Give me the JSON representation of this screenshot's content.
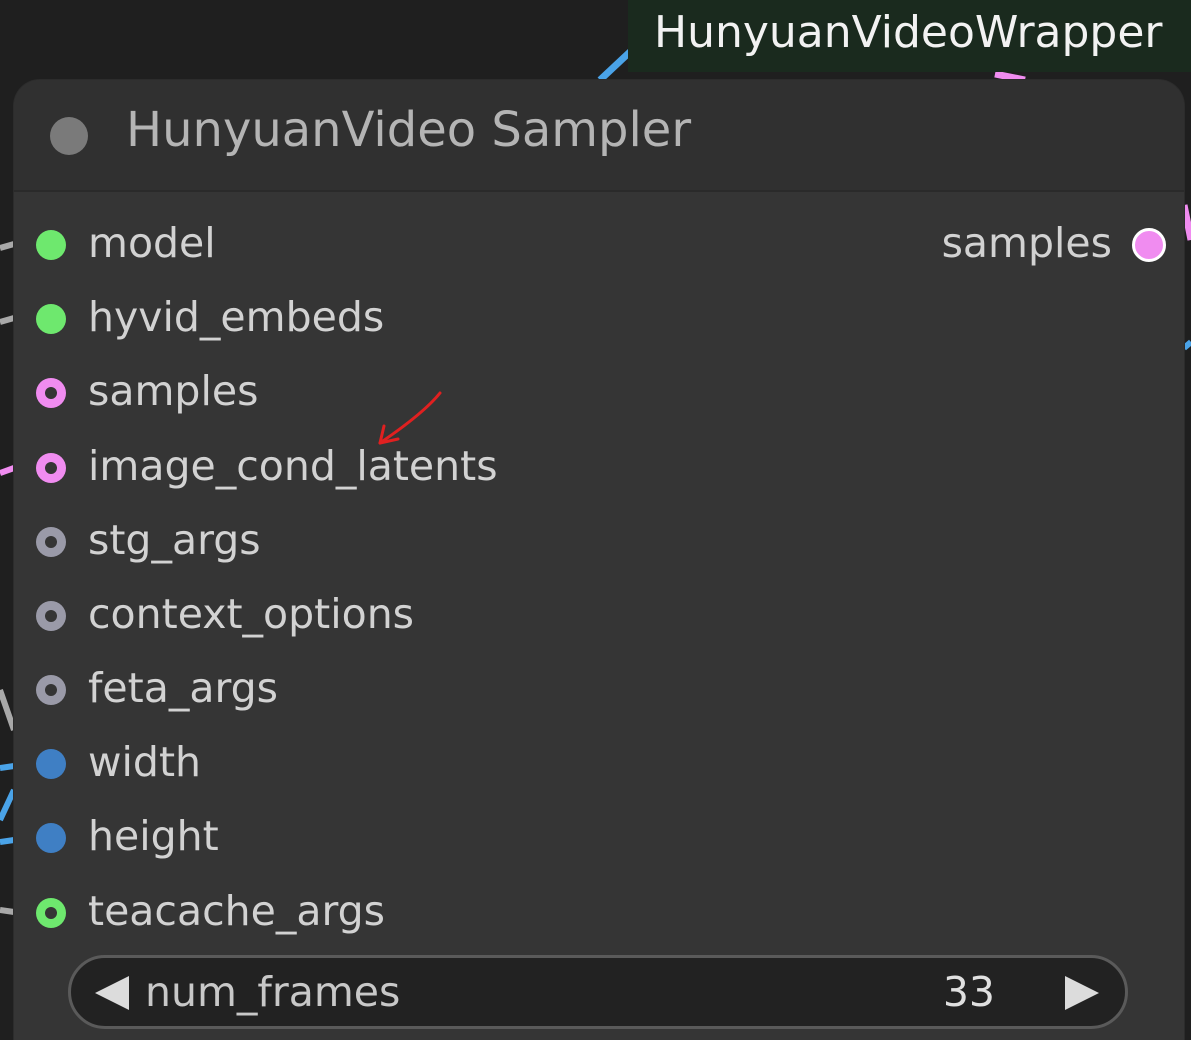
{
  "group": {
    "title": "HunyuanVideoWrapper"
  },
  "node": {
    "title": "HunyuanVideo Sampler",
    "inputs": [
      {
        "label": "model",
        "color": "#6ee86e",
        "style": "filled"
      },
      {
        "label": "hyvid_embeds",
        "color": "#6ee86e",
        "style": "filled"
      },
      {
        "label": "samples",
        "color": "#f08cf0",
        "style": "ring"
      },
      {
        "label": "image_cond_latents",
        "color": "#f08cf0",
        "style": "ring"
      },
      {
        "label": "stg_args",
        "color": "#9a9aa8",
        "style": "ring"
      },
      {
        "label": "context_options",
        "color": "#9a9aa8",
        "style": "ring"
      },
      {
        "label": "feta_args",
        "color": "#9a9aa8",
        "style": "ring"
      },
      {
        "label": "width",
        "color": "#3f7fc4",
        "style": "filled"
      },
      {
        "label": "height",
        "color": "#3f7fc4",
        "style": "filled"
      },
      {
        "label": "teacache_args",
        "color": "#6ee86e",
        "style": "ring"
      }
    ],
    "outputs": [
      {
        "label": "samples",
        "color": "#f08cf0"
      }
    ],
    "widget": {
      "label": "num_frames",
      "value": "33"
    }
  },
  "colors": {
    "wire_blue": "#4aa3e8",
    "wire_pink": "#f08cf0",
    "wire_gray": "#a8a8a8",
    "annotation_red": "#e02020"
  }
}
